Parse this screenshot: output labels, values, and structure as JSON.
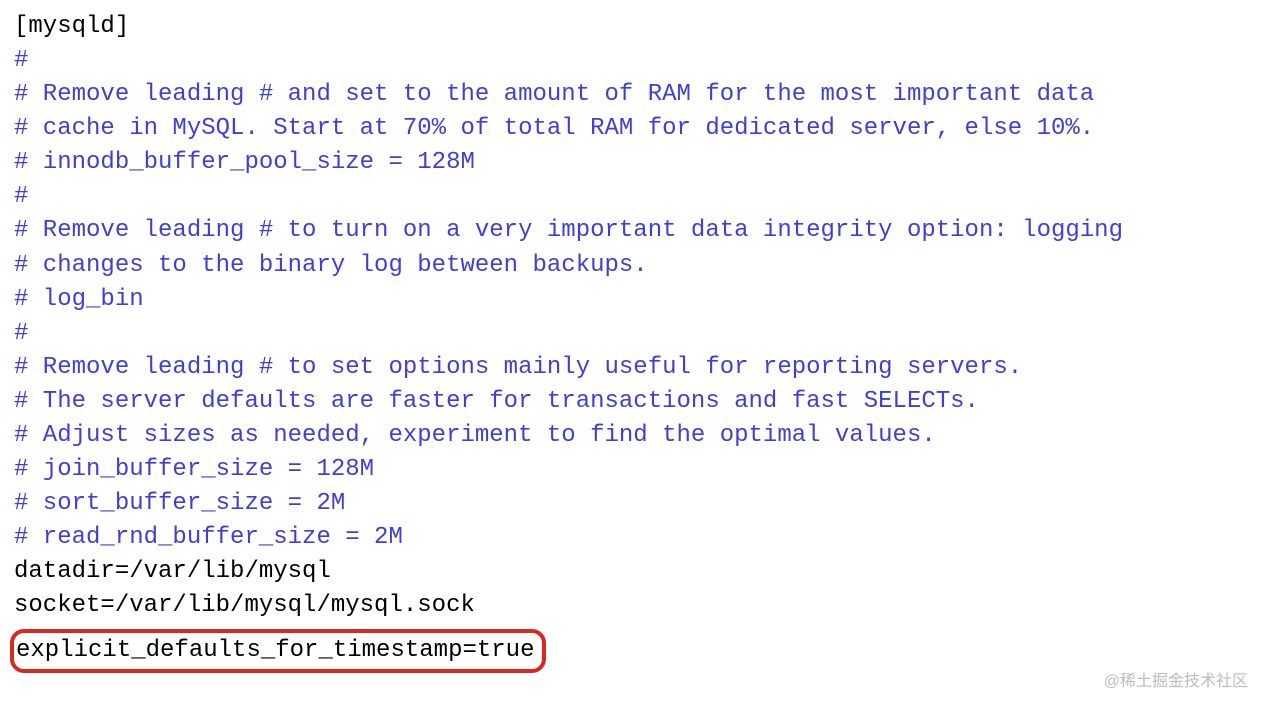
{
  "lines": {
    "l1": "[mysqld]",
    "l2": "#",
    "l3": "# Remove leading # and set to the amount of RAM for the most important data",
    "l4": "# cache in MySQL. Start at 70% of total RAM for dedicated server, else 10%.",
    "l5": "# innodb_buffer_pool_size = 128M",
    "l6": "#",
    "l7": "# Remove leading # to turn on a very important data integrity option: logging",
    "l8": "# changes to the binary log between backups.",
    "l9": "# log_bin",
    "l10": "#",
    "l11": "# Remove leading # to set options mainly useful for reporting servers.",
    "l12": "# The server defaults are faster for transactions and fast SELECTs.",
    "l13": "# Adjust sizes as needed, experiment to find the optimal values.",
    "l14": "# join_buffer_size = 128M",
    "l15": "# sort_buffer_size = 2M",
    "l16": "# read_rnd_buffer_size = 2M",
    "l17": "datadir=/var/lib/mysql",
    "l18": "socket=/var/lib/mysql/mysql.sock",
    "l19": "explicit_defaults_for_timestamp=true"
  },
  "watermark": "@稀土掘金技术社区"
}
